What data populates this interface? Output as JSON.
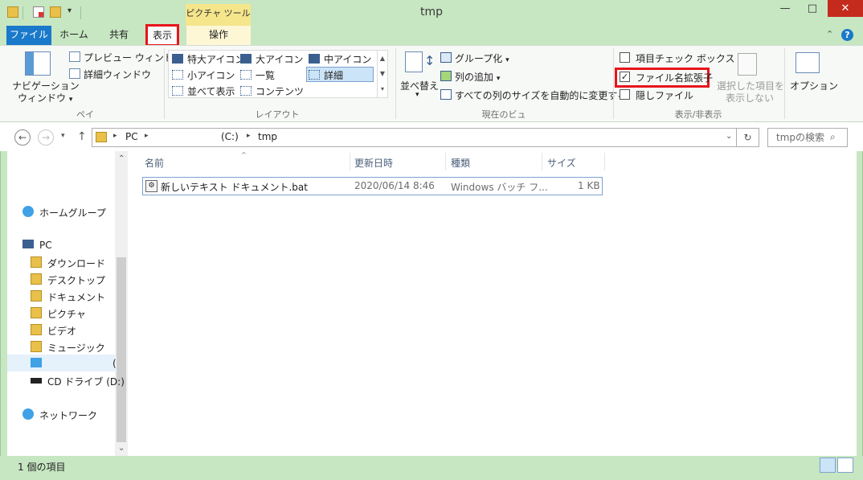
{
  "window": {
    "title": "tmp",
    "minimize": "—",
    "maximize": "□",
    "close": "✕",
    "context_tab_group": "ピクチャ ツール"
  },
  "tabs": {
    "file": "ファイル",
    "home": "ホーム",
    "share": "共有",
    "view": "表示",
    "manage": "操作"
  },
  "ribbon": {
    "pane": {
      "navigation_pane_line1": "ナビゲーション",
      "navigation_pane_line2": "ウィンドウ",
      "preview_pane": "プレビュー ウィンドウ",
      "details_pane": "詳細ウィンドウ",
      "group_label": "ペイン"
    },
    "layout": {
      "extra_large_icons": "特大アイコン",
      "large_icons": "大アイコン",
      "medium_icons": "中アイコン",
      "small_icons": "小アイコン",
      "list": "一覧",
      "details": "詳細",
      "tiles": "並べて表示",
      "content": "コンテンツ",
      "group_label": "レイアウト"
    },
    "current_view": {
      "sort_by": "並べ替え",
      "group_by": "グループ化",
      "add_columns": "列の追加",
      "size_all_columns": "すべての列のサイズを自動的に変更する",
      "group_label": "現在のビュー"
    },
    "show_hide": {
      "item_checkboxes": "項目チェック ボックス",
      "item_checkboxes_checked": false,
      "file_name_extensions": "ファイル名拡張子",
      "file_name_extensions_checked": true,
      "hidden_items": "隠しファイル",
      "hidden_items_checked": false,
      "hide_selected_line1": "選択した項目を",
      "hide_selected_line2": "表示しない",
      "group_label": "表示/非表示"
    },
    "options": "オプション"
  },
  "address": {
    "path": [
      "PC",
      "(C:)",
      "tmp"
    ],
    "search_placeholder": "tmpの検索"
  },
  "nav": {
    "homegroup": "ホームグループ",
    "pc": "PC",
    "downloads": "ダウンロード",
    "desktop": "デスクトップ",
    "documents": "ドキュメント",
    "pictures": "ピクチャ",
    "videos": "ビデオ",
    "music": "ミュージック",
    "drive_c": "(",
    "cd_drive": "CD ドライブ (D:)",
    "network": "ネットワーク"
  },
  "columns": [
    "名前",
    "更新日時",
    "種類",
    "サイズ"
  ],
  "files": [
    {
      "name": "新しいテキスト ドキュメント.bat",
      "modified": "2020/06/14 8:46",
      "type": "Windows バッチ フ...",
      "size": "1 KB"
    }
  ],
  "status": {
    "item_count": "1 個の項目"
  },
  "colors": {
    "frame": "#c7e6c2",
    "file_tab": "#1979ca",
    "highlight": "#e8141b",
    "context_tab": "#f5e68c"
  }
}
